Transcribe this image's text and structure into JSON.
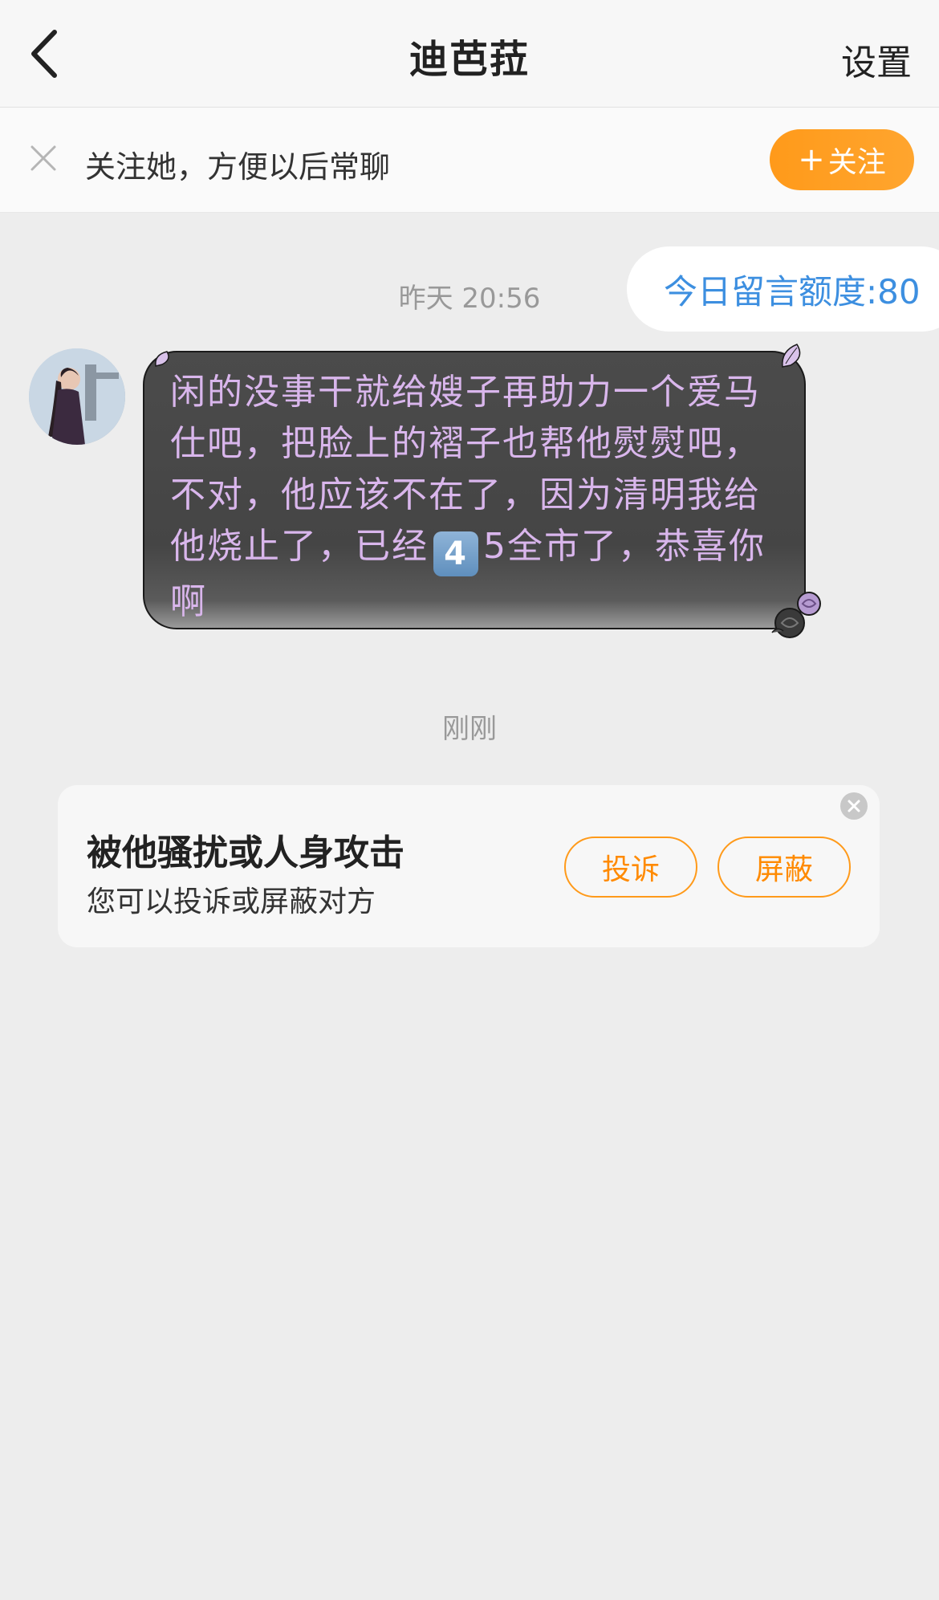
{
  "header": {
    "title": "迪芭菈",
    "settings_label": "设置"
  },
  "follow_bar": {
    "prompt": "关注她，方便以后常聊",
    "follow_button_label": "关注"
  },
  "chat": {
    "quota_text": "今日留言额度:80",
    "timestamp_1": "昨天 20:56",
    "message": {
      "part_1": "闲的没事干就给嫂子再助力一个爱马仕吧，把脸上的褶子也帮他熨熨吧，不对，他应该不在了，因为清明我给他烧止了，已经",
      "keycap": "4",
      "part_2": "5全市了，恭喜你啊",
      "text_color": "#d9b6ec"
    },
    "timestamp_2": "刚刚"
  },
  "report_card": {
    "title": "被他骚扰或人身攻击",
    "subtitle": "您可以投诉或屏蔽对方",
    "report_button_label": "投诉",
    "block_button_label": "屏蔽",
    "accent_color": "#ff9a1a"
  }
}
